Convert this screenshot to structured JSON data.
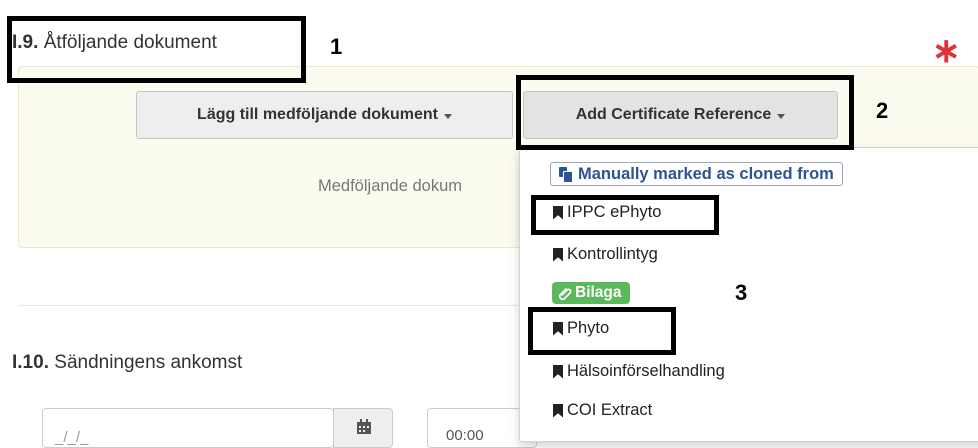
{
  "section_i9": {
    "number": "I.9.",
    "title": "Åtföljande dokument",
    "required_mark": "∗"
  },
  "buttons": {
    "add_accompanying": "Lägg till medföljande dokument",
    "add_certificate_ref": "Add Certificate Reference"
  },
  "empty_hint": "Medföljande dokum",
  "dropdown": {
    "cloned_label": "Manually marked as cloned from",
    "items": [
      "IPPC ePhyto",
      "Kontrollintyg",
      "Bilaga",
      "Phyto",
      "Hälsoinförselhandling",
      "COI Extract"
    ]
  },
  "section_i10": {
    "number": "I.10.",
    "title": "Sändningens ankomst"
  },
  "date_input": {
    "value": "_/_/_"
  },
  "time_input": {
    "value": "00:00"
  },
  "annotations": [
    "1",
    "2",
    "3"
  ],
  "icons": {
    "cloned": "copy-icon",
    "bookmark": "bookmark-icon",
    "bilaga": "paperclip-icon",
    "calendar": "calendar-icon"
  }
}
